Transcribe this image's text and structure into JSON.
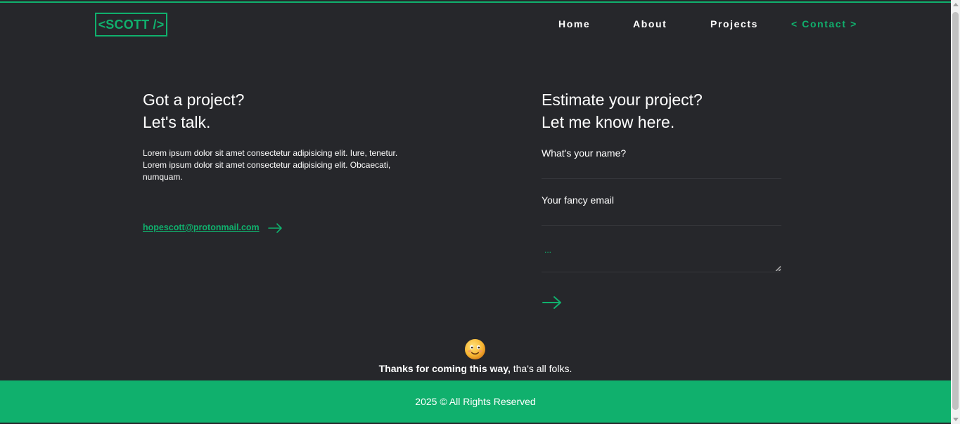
{
  "header": {
    "logo": "<SCOTT />",
    "nav": [
      {
        "label": "Home",
        "active": false
      },
      {
        "label": "About",
        "active": false
      },
      {
        "label": "Projects",
        "active": false
      },
      {
        "label": "< Contact >",
        "active": true
      }
    ]
  },
  "contact": {
    "title_line1": "Got a project?",
    "title_line2": "Let's talk.",
    "description": "Lorem ipsum dolor sit amet consectetur adipisicing elit. Iure, tenetur. Lorem ipsum dolor sit amet consectetur adipisicing elit. Obcaecati, numquam.",
    "email": "hopescott@protonmail.com"
  },
  "form": {
    "title_line1": "Estimate your project?",
    "title_line2": "Let me know here.",
    "name_label": "What's your name?",
    "name_value": "",
    "email_label": "Your fancy email",
    "email_value": "",
    "message_placeholder": "...",
    "message_value": ""
  },
  "closing": {
    "emoji": "smiling-face-emoji",
    "thanks_bold": "Thanks for coming this way,",
    "thanks_rest": " tha's all folks."
  },
  "footer": {
    "text": "2025 © All Rights Reserved"
  },
  "colors": {
    "background": "#26272b",
    "accent": "#10b06d",
    "text": "#ffffff"
  }
}
